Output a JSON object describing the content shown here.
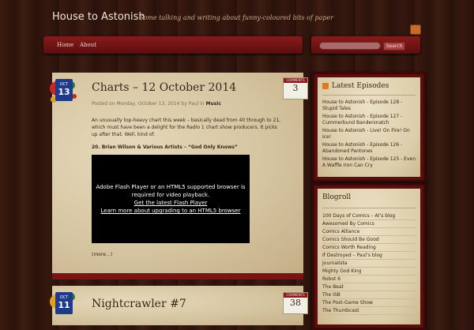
{
  "site": {
    "title": "House to Astonish",
    "description": "Some talking and writing about funny-coloured bits of paper"
  },
  "nav": {
    "items": [
      "Home",
      "About"
    ]
  },
  "search": {
    "placeholder": "",
    "button_label": "Search"
  },
  "posts": [
    {
      "month": "OCT",
      "day": "13",
      "title": "Charts – 12 October 2014",
      "comments_label": "COMMENTS",
      "comments_count": "3",
      "meta_prefix": "Posted on Monday, October 13, 2014 by",
      "author": "Paul",
      "meta_in": "in",
      "category": "Music",
      "body": "An unusually top-heavy chart this week – basically dead from 40 through to 21, which must have been a delight for the Radio 1 chart show producers.  It picks up after that.  Well, kind of.",
      "track": "20.  Brian Wilson & Various Artists – “God Only Knows”",
      "video": {
        "line1": "Adobe Flash Player or an HTML5 supported browser is",
        "line2": "required for video playback.",
        "link1": "Get the latest Flash Player",
        "link2": "Learn more about upgrading to an HTML5 browser"
      },
      "more": "(more…)"
    },
    {
      "month": "OCT",
      "day": "11",
      "title": "Nightcrawler #7",
      "comments_label": "COMMENTS",
      "comments_count": "38"
    }
  ],
  "sidebar": {
    "episodes": {
      "title": "Latest Episodes",
      "items": [
        "House to Astonish - Episode 128 - Stupid Tales",
        "House to Astonish - Episode 127 - Cummerbund Bandersnatch",
        "House to Astonish - Live! On Fire! On Ice!",
        "House to Astonish - Episode 126 - Abandoned Pantones",
        "House to Astonish - Episode 125 - Even A Waffle Iron Can Cry"
      ]
    },
    "blogroll": {
      "title": "Blogroll",
      "items": [
        "100 Days of Comics – Al’s blog",
        "Awesomed By Comics",
        "Comics Alliance",
        "Comics Should Be Good",
        "Comics Worth Reading",
        "If Destroyed – Paul’s blog",
        "Journalista",
        "Mighty God King",
        "Robot 6",
        "The Beat",
        "The ISB",
        "The Post-Game Show",
        "The Thumbcast"
      ]
    }
  },
  "colors": {
    "nav_red": "#8a1a1a",
    "date_blue": "#1e3a8a",
    "paper": "#d9cba9"
  }
}
